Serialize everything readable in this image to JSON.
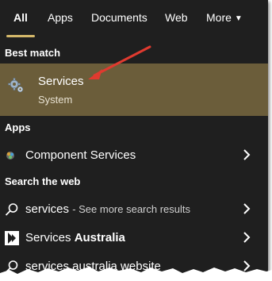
{
  "tabs": [
    {
      "label": "All",
      "active": true
    },
    {
      "label": "Apps",
      "active": false
    },
    {
      "label": "Documents",
      "active": false
    },
    {
      "label": "Web",
      "active": false
    },
    {
      "label": "More",
      "active": false
    }
  ],
  "best_match": {
    "header": "Best match",
    "title": "Services",
    "subtitle": "System",
    "icon": "gear-icon"
  },
  "apps": {
    "header": "Apps",
    "items": [
      {
        "label": "Component Services",
        "icon": "component-services-icon"
      }
    ]
  },
  "web": {
    "header": "Search the web",
    "items": [
      {
        "label": "services",
        "suffix": "- See more search results",
        "icon": "search-icon"
      },
      {
        "label_plain": "Services ",
        "label_bold": "Australia",
        "icon": "bing-icon"
      },
      {
        "label": "services australia website",
        "icon": "search-icon"
      }
    ]
  },
  "colors": {
    "background": "#1f1f1f",
    "highlight": "#6b5d3a",
    "accent": "#d4b86a",
    "annotation_arrow": "#e03a2f"
  }
}
